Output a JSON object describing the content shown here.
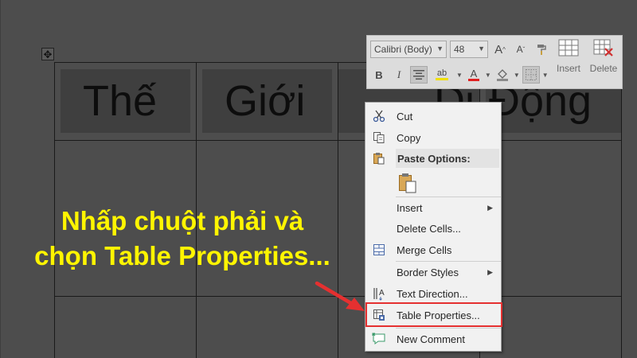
{
  "table": {
    "header_cells": [
      "Thế",
      "Giới",
      "Di",
      "Động"
    ]
  },
  "mini_toolbar": {
    "font_name": "Calibri (Body)",
    "font_size": "48",
    "bold_label": "B",
    "italic_label": "I",
    "grow_font_label": "A",
    "shrink_font_label": "A",
    "font_color_label": "A",
    "highlight_label": "ab",
    "insert_label": "Insert",
    "delete_label": "Delete"
  },
  "context_menu": {
    "items": [
      {
        "label": "Cut",
        "icon": "scissors-icon"
      },
      {
        "label": "Copy",
        "icon": "copy-icon"
      },
      {
        "label": "Paste Options:",
        "icon": "paste-icon"
      },
      {
        "label": "Insert",
        "icon": ""
      },
      {
        "label": "Delete Cells...",
        "icon": ""
      },
      {
        "label": "Merge Cells",
        "icon": "merge-cells-icon"
      },
      {
        "label": "Border Styles",
        "icon": ""
      },
      {
        "label": "Text Direction...",
        "icon": "text-direction-icon"
      },
      {
        "label": "Table Properties...",
        "icon": "table-properties-icon"
      },
      {
        "label": "New Comment",
        "icon": "comment-icon"
      }
    ]
  },
  "caption": {
    "line1": "Nhấp chuột phải và",
    "line2": "chọn Table Properties..."
  },
  "colors": {
    "caption": "#fff500",
    "highlight_border": "#e53030",
    "arrow": "#e53030"
  }
}
